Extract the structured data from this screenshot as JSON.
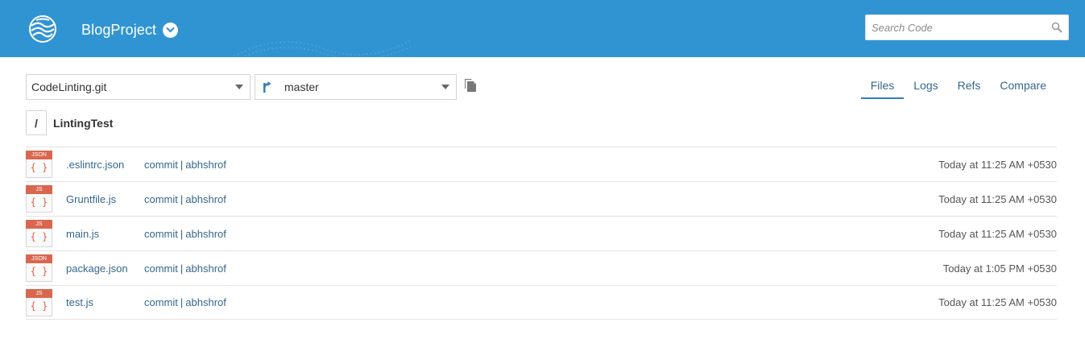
{
  "header": {
    "project_name": "BlogProject",
    "search": {
      "placeholder": "Search Code"
    }
  },
  "toolbar": {
    "repository": "CodeLinting.git",
    "branch": "master"
  },
  "tabs": [
    {
      "label": "Files",
      "active": true
    },
    {
      "label": "Logs",
      "active": false
    },
    {
      "label": "Refs",
      "active": false
    },
    {
      "label": "Compare",
      "active": false
    }
  ],
  "breadcrumb": {
    "root": "/",
    "folder": "LintingTest"
  },
  "files": [
    {
      "type": "JSON",
      "icon": "{ }",
      "name": ".eslintrc.json",
      "commit": "commit",
      "author": "abhshrof",
      "time": "Today at 11:25 AM +0530"
    },
    {
      "type": "JS",
      "icon": "{ }",
      "name": "Gruntfile.js",
      "commit": "commit",
      "author": "abhshrof",
      "time": "Today at 11:25 AM +0530"
    },
    {
      "type": "JS",
      "icon": "{ }",
      "name": "main.js",
      "commit": "commit",
      "author": "abhshrof",
      "time": "Today at 11:25 AM +0530"
    },
    {
      "type": "JSON",
      "icon": "{ }",
      "name": "package.json",
      "commit": "commit",
      "author": "abhshrof",
      "time": "Today at 1:05 PM +0530"
    },
    {
      "type": "JS",
      "icon": "{ }",
      "name": "test.js",
      "commit": "commit",
      "author": "abhshrof",
      "time": "Today at 11:25 AM +0530"
    }
  ],
  "colors": {
    "header_bg": "#3194d2",
    "link": "#35678e",
    "file_tag": "#d9674f",
    "tab_underline": "#2f7fbd"
  },
  "icons": {
    "logo": "globe-logo-icon",
    "project_chevron": "chevron-down-circle-icon",
    "search": "magnifier-icon",
    "branch": "git-branch-icon",
    "copy": "copy-icon",
    "file": "file-type-icon"
  }
}
